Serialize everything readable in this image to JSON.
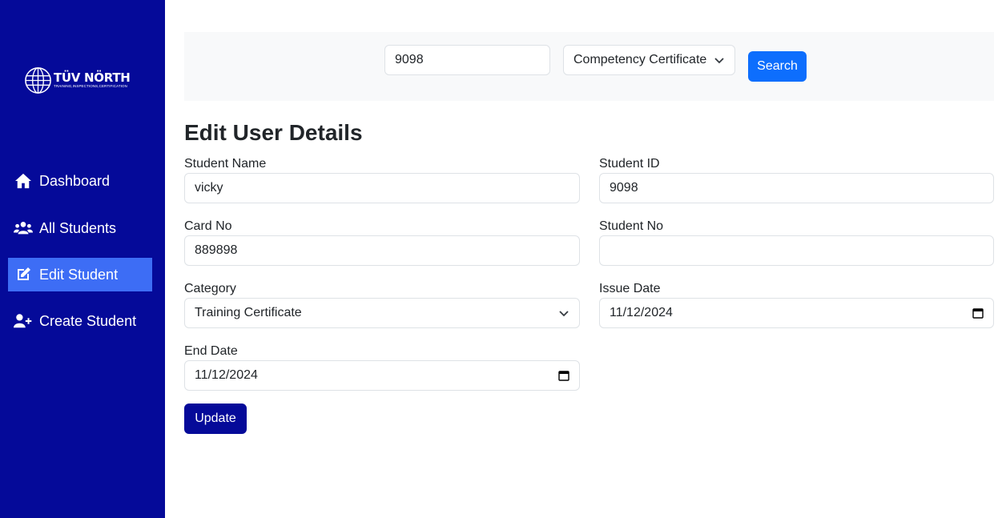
{
  "brand": {
    "name": "TÜV NÖRTH",
    "tagline": "TRAINING,INSPECTIONS,CERTIFICATION"
  },
  "sidebar": {
    "items": [
      {
        "label": "Dashboard",
        "icon": "home-icon",
        "active": false
      },
      {
        "label": "All Students",
        "icon": "users-icon",
        "active": false
      },
      {
        "label": "Edit Student",
        "icon": "edit-icon",
        "active": true
      },
      {
        "label": "Create Student",
        "icon": "user-plus-icon",
        "active": false
      }
    ]
  },
  "search": {
    "query_value": "9098",
    "type_selected": "Competency Certificate",
    "button_label": "Search"
  },
  "form": {
    "title": "Edit User Details",
    "student_name": {
      "label": "Student Name",
      "value": "vicky"
    },
    "student_id": {
      "label": "Student ID",
      "value": "9098"
    },
    "card_no": {
      "label": "Card No",
      "value": "889898"
    },
    "student_no": {
      "label": "Student No",
      "value": ""
    },
    "category": {
      "label": "Category",
      "value": "Training Certificate"
    },
    "issue_date": {
      "label": "Issue Date",
      "value": "11/12/2024"
    },
    "end_date": {
      "label": "End Date",
      "value": "11/12/2024"
    },
    "update_label": "Update"
  },
  "colors": {
    "sidebar_bg": "#050a99",
    "active_nav": "#3d6df5",
    "primary": "#0d6efd",
    "update_btn": "#050a99"
  }
}
